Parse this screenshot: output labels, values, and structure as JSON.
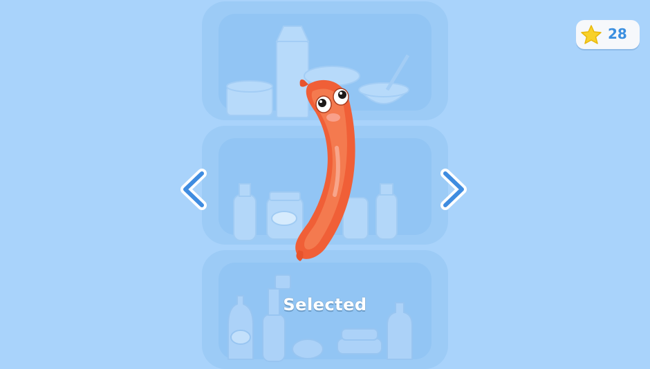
{
  "hud": {
    "star_icon": "star-icon",
    "star_count": "28"
  },
  "navigation": {
    "prev_icon": "chevron-left-icon",
    "next_icon": "chevron-right-icon"
  },
  "character": {
    "name_icon": "sausage-character"
  },
  "status": {
    "label": "Selected"
  },
  "colors": {
    "background": "#a9d3fb",
    "sausage": "#f2603a",
    "star": "#f8d12a",
    "score_text": "#3b8fe0"
  }
}
